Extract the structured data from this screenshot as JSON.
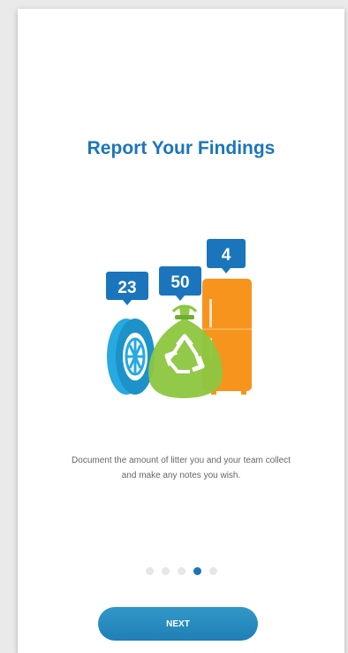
{
  "screen": {
    "title": "Report Your Findings",
    "description": "Document the amount of litter you and your team collect and make any notes you wish.",
    "next_label": "NEXT"
  },
  "illustration": {
    "tire_count": "23",
    "bag_count": "50",
    "fridge_count": "4"
  },
  "pagination": {
    "total_pages": 5,
    "active_index": 3
  },
  "colors": {
    "accent": "#1b75bc",
    "tire": "#27a9e1",
    "bag": "#8dc63f",
    "fridge": "#f7941d",
    "badge": "#1b75bc"
  }
}
